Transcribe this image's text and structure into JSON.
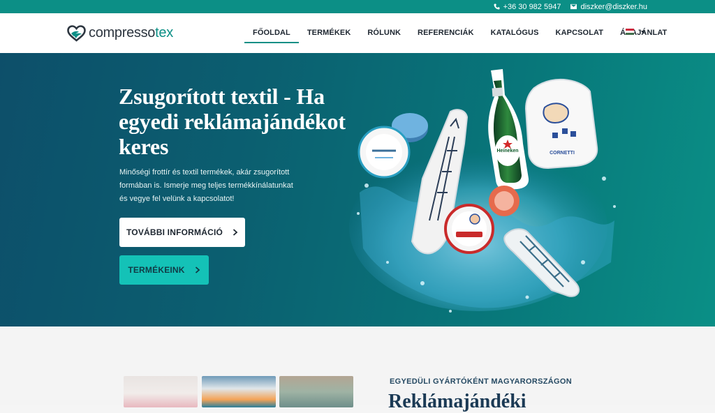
{
  "topbar": {
    "phone": "+36 30 982 5947",
    "email": "diszker@diszker.hu",
    "phone_icon": "phone-icon",
    "email_icon": "envelope-icon"
  },
  "logo": {
    "text_main": "compresso",
    "text_accent": "tex"
  },
  "nav": {
    "items": [
      {
        "label": "FŐOLDAL",
        "active": true
      },
      {
        "label": "TERMÉKEK",
        "active": false
      },
      {
        "label": "RÓLUNK",
        "active": false
      },
      {
        "label": "REFERENCIÁK",
        "active": false
      },
      {
        "label": "KATALÓGUS",
        "active": false
      },
      {
        "label": "KAPCSOLAT",
        "active": false
      },
      {
        "label": "ÁRAJÁNLAT",
        "active": false
      }
    ],
    "language_icon": "hungarian-flag-icon"
  },
  "hero": {
    "title": "Zsugorított textil - Ha egyedi reklámajándékot keres",
    "description": "Minőségi frottír és textil termékek, akár zsugorított formában is. Ismerje meg teljes termékkínálatunkat és vegye fel velünk a kapcsolatot!",
    "btn_more": "TOVÁBBI INFORMÁCIÓ",
    "btn_products": "TERMÉKEINK"
  },
  "section2": {
    "eyebrow": "EGYEDÜLI GYÁRTÓKÉNT MAGYARORSZÁGON",
    "heading": "Reklámajándéki"
  },
  "colors": {
    "brand": "#0c8f86",
    "accent_button": "#14c2b7",
    "dark_text": "#1d2630",
    "heading_navy": "#1b3a55"
  }
}
